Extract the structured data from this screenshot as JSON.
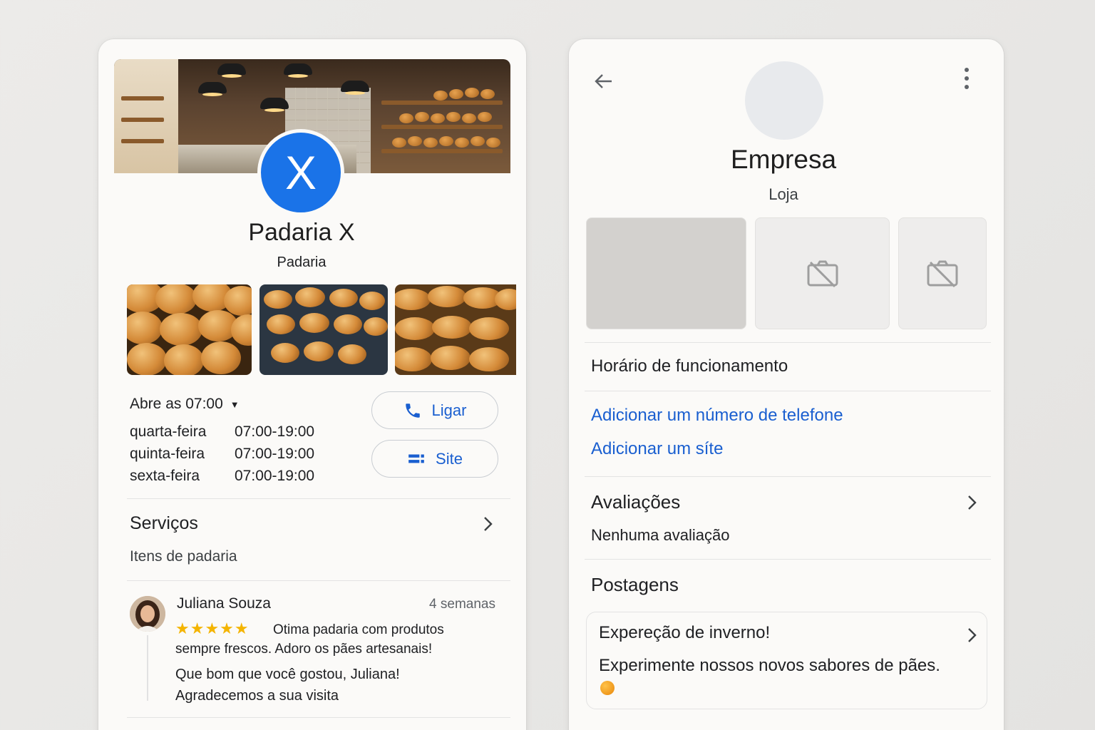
{
  "left_screen": {
    "avatar_letter": "X",
    "name": "Padaria X",
    "category": "Padaria",
    "hours": {
      "toggle_label": "Abre as 07:00",
      "rows": [
        {
          "day": "quarta-feira",
          "time": "07:00-19:00"
        },
        {
          "day": "quinta-feira",
          "time": "07:00-19:00"
        },
        {
          "day": "sexta-feira",
          "time": "07:00-19:00"
        }
      ]
    },
    "actions": {
      "call_label": "Ligar",
      "site_label": "Site"
    },
    "services": {
      "title": "Serviços",
      "subtitle": "Itens de padaria"
    },
    "review": {
      "author": "Juliana Souza",
      "time": "4 semanas",
      "stars": "★★★★★",
      "rating": 5,
      "text_line1": "Otima padaria com produtos",
      "text_line2": "sempre frescos. Adoro os pães artesanais!",
      "reply_line1": "Que bom que você gostou, Juliana!",
      "reply_line2": "Agradecemos a sua visita"
    }
  },
  "right_screen": {
    "name": "Empresa",
    "category": "Loja",
    "hours_title": "Horário de funcionamento",
    "add_phone_link": "Adicionar um número de telefone",
    "add_site_link": "Adicionar um síte",
    "reviews": {
      "title": "Avaliações",
      "subtitle": "Nenhuma avaliação"
    },
    "posts": {
      "title": "Postagens",
      "post_title": "Expereção de inverno!",
      "post_body": "Experimente nossos novos sabores de pães."
    }
  },
  "colors": {
    "accent_blue": "#1a73e8",
    "link_blue": "#1a5fd0",
    "star_yellow": "#f4b400"
  }
}
